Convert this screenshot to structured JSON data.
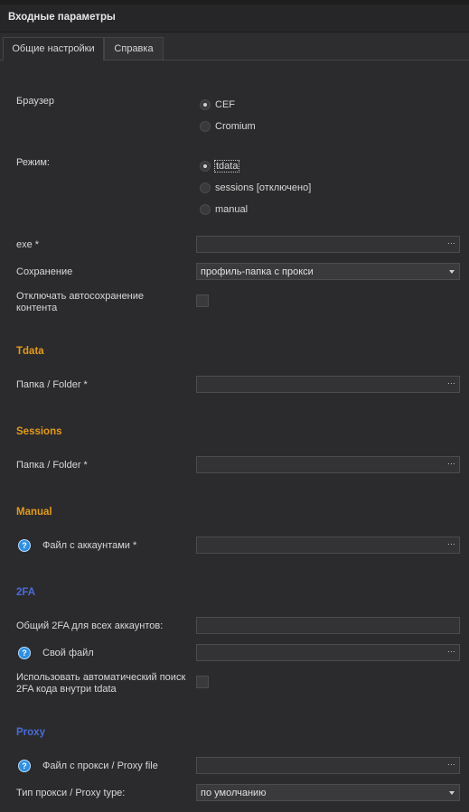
{
  "panel": {
    "title": "Входные параметры"
  },
  "tabs": [
    {
      "label": "Общие настройки",
      "active": true
    },
    {
      "label": "Справка",
      "active": false
    }
  ],
  "browser": {
    "label": "Браузер",
    "options": [
      {
        "label": "CEF",
        "selected": true
      },
      {
        "label": "Cromium",
        "selected": false
      }
    ]
  },
  "mode": {
    "label": "Режим:",
    "options": [
      {
        "label": "tdata",
        "selected": true
      },
      {
        "label": "sessions [отключено]",
        "selected": false
      },
      {
        "label": "manual",
        "selected": false
      }
    ]
  },
  "exe": {
    "label": "exe *",
    "value": "",
    "browse": "···"
  },
  "saving": {
    "label": "Сохранение",
    "selected": "профиль-папка с прокси"
  },
  "autosave": {
    "label_line1": "Отключать автосохранение",
    "label_line2": "контента",
    "checked": false
  },
  "tdata": {
    "heading": "Tdata",
    "folder_label": "Папка / Folder *",
    "value": "",
    "browse": "···"
  },
  "sessions": {
    "heading": "Sessions",
    "folder_label": "Папка / Folder *",
    "value": "",
    "browse": "···"
  },
  "manual": {
    "heading": "Manual",
    "file_label": "Файл с аккаунтами *",
    "value": "",
    "browse": "···",
    "help": "?"
  },
  "twofa": {
    "heading": "2FA",
    "common_label": "Общий 2FA для всех аккаунтов:",
    "common_value": "",
    "own_file_label": "Свой файл",
    "own_file_value": "",
    "browse": "···",
    "help": "?",
    "auto_label_line1": "Использовать автоматический поиск",
    "auto_label_line2": "2FA кода внутри tdata",
    "auto_checked": false
  },
  "proxy": {
    "heading": "Proxy",
    "file_label": "Файл с прокси / Proxy file",
    "file_value": "",
    "browse": "···",
    "help": "?",
    "type_label": "Тип прокси / Proxy type:",
    "type_selected": "по умолчанию"
  },
  "colors": {
    "section_orange": "#e39a1c",
    "section_blue": "#4a6cd8",
    "help_icon": "#2f8fe0",
    "background": "#2b2b2d"
  }
}
